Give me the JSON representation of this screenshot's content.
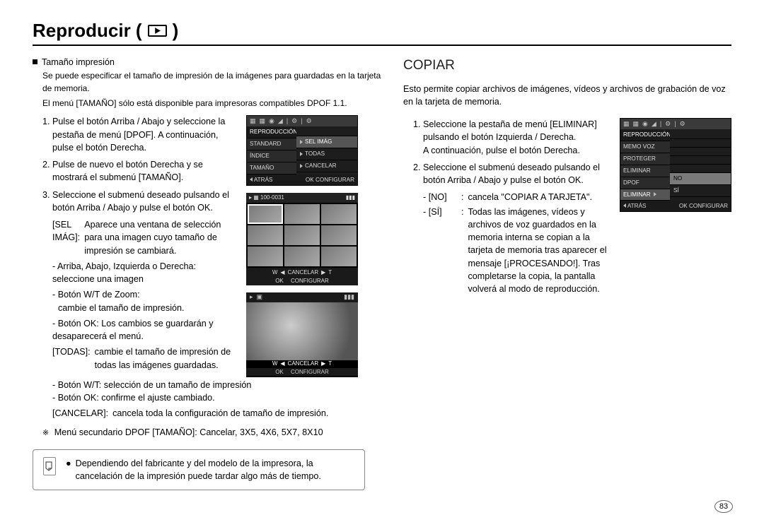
{
  "title": "Reproducir (",
  "title_close": ")",
  "left": {
    "heading": "Tamaño impresión",
    "p1": "Se puede especificar el tamaño de impresión de la imágenes para guardadas en la tarjeta de memoria.",
    "p2": "El menú [TAMAÑO] sólo está disponible para impresoras compatibles DPOF 1.1.",
    "s1": "Pulse el botón Arriba / Abajo y seleccione la pestaña de menú [DPOF]. A continuación, pulse el botón Derecha.",
    "s2": "Pulse de nuevo el botón Derecha y se mostrará el submenú [TAMAÑO].",
    "s3": "Seleccione el submenú deseado pulsando el botón Arriba / Abajo y pulse el botón OK.",
    "sel_label": "[SEL IMÁG]:",
    "sel_text": "Aparece una ventana de selección para una imagen cuyo tamaño de impresión se cambiará.",
    "arrow": "- Arriba, Abajo, Izquierda o Derecha: seleccione una imagen",
    "wt": "- Botón W/T de Zoom:",
    "wt2": "cambie el tamaño de impresión.",
    "ok": "- Botón OK: Los cambios se guardarán y desaparecerá el menú.",
    "todas_label": "[TODAS]:",
    "todas_text": "cambie el tamaño de impresión de todas las imágenes guardadas.",
    "wt_sel": "- Botón W/T: selección de un tamaño de impresión",
    "ok_conf": "- Botón OK: confirme el ajuste cambiado.",
    "cancel_label": "[CANCELAR]:",
    "cancel_text": "cancela toda la configuración de tamaño de impresión.",
    "secondary_prefix": "※",
    "secondary": "Menú secundario DPOF [TAMAÑO]: Cancelar, 3X5, 4X6, 5X7, 8X10",
    "note": "Dependiendo del fabricante y del modelo de la impresora, la cancelación de la impresión puede tardar algo más de tiempo."
  },
  "right": {
    "heading": "COPIAR",
    "intro": "Esto permite copiar archivos de imágenes, vídeos y archivos de grabación de voz en la tarjeta de memoria.",
    "s1a": "Seleccione la pestaña de menú [ELIMINAR] pulsando el botón Izquierda / Derecha.",
    "s1b": "A continuación, pulse el botón Derecha.",
    "s2": "Seleccione el submenú deseado pulsando el botón Arriba / Abajo y pulse el botón OK.",
    "no_key": "- [NO]",
    "no_sep": ":",
    "no_text": "cancela \"COPIAR A TARJETA\".",
    "si_key": "- [SÍ]",
    "si_sep": ":",
    "si_text": "Todas las imágenes, vídeos y archivos de voz guardados en la memoria interna se copian a la tarjeta de memoria tras aparecer el mensaje [¡PROCESANDO!]. Tras completarse la copia, la pantalla volverá al modo de reproducción."
  },
  "menu1": {
    "head": "REPRODUCCIÓN",
    "l1": "STANDARD",
    "l2": "ÍNDICE",
    "l3": "TAMAÑO",
    "r1": "SEL IMÁG",
    "r2": "TODAS",
    "r3": "CANCELAR",
    "back": "ATRÁS",
    "ok": "OK",
    "conf": "CONFIGURAR"
  },
  "thumb": {
    "num": "100-0031",
    "w": "W",
    "t": "T",
    "cancel": "CANCELAR",
    "ok": "OK",
    "conf": "CONFIGURAR"
  },
  "photo": {
    "w": "W",
    "t": "T",
    "cancel": "CANCELAR",
    "ok": "OK",
    "conf": "CONFIGURAR"
  },
  "menu2": {
    "head": "REPRODUCCIÓN",
    "l1": "MEMO VOZ",
    "l2": "PROTEGER",
    "l3": "ELIMINAR",
    "l4": "DPOF",
    "l5": "ELIMINAR",
    "r1": "NO",
    "r2": "SÍ",
    "back": "ATRÁS",
    "ok": "OK",
    "conf": "CONFIGURAR"
  },
  "page_num": "83"
}
